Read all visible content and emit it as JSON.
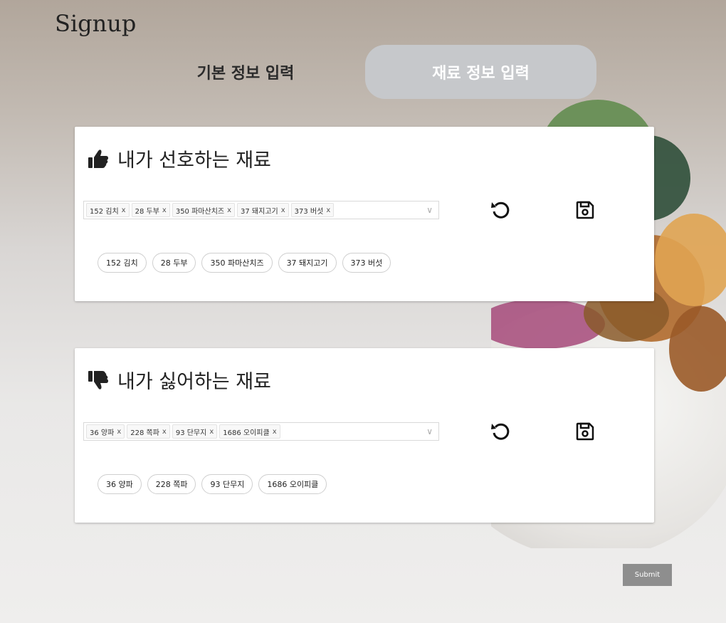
{
  "header": {
    "title": "Signup"
  },
  "tabs": [
    {
      "label": "기본 정보 입력",
      "active": false
    },
    {
      "label": "재료 정보 입력",
      "active": true
    }
  ],
  "liked": {
    "title": "내가 선호하는 재료",
    "icon": "thumbs-up-icon",
    "selected": [
      {
        "label": "152 김치"
      },
      {
        "label": "28 두부"
      },
      {
        "label": "350 파마산치즈"
      },
      {
        "label": "37 돼지고기"
      },
      {
        "label": "373 버섯"
      }
    ],
    "chips": [
      "152 김치",
      "28 두부",
      "350 파마산치즈",
      "37 돼지고기",
      "373 버섯"
    ]
  },
  "disliked": {
    "title": "내가 싫어하는 재료",
    "icon": "thumbs-down-icon",
    "selected": [
      {
        "label": "36 양파"
      },
      {
        "label": "228 쪽파"
      },
      {
        "label": "93 단무지"
      },
      {
        "label": "1686 오이피클"
      }
    ],
    "chips": [
      "36 양파",
      "228 쪽파",
      "93 단무지",
      "1686 오이피클"
    ]
  },
  "tag_remove_glyph": "x",
  "select_arrow_glyph": "∨",
  "submit_label": "Submit",
  "colors": {
    "active_tab": "#c6c8cb",
    "submit": "#8e8e8e"
  }
}
